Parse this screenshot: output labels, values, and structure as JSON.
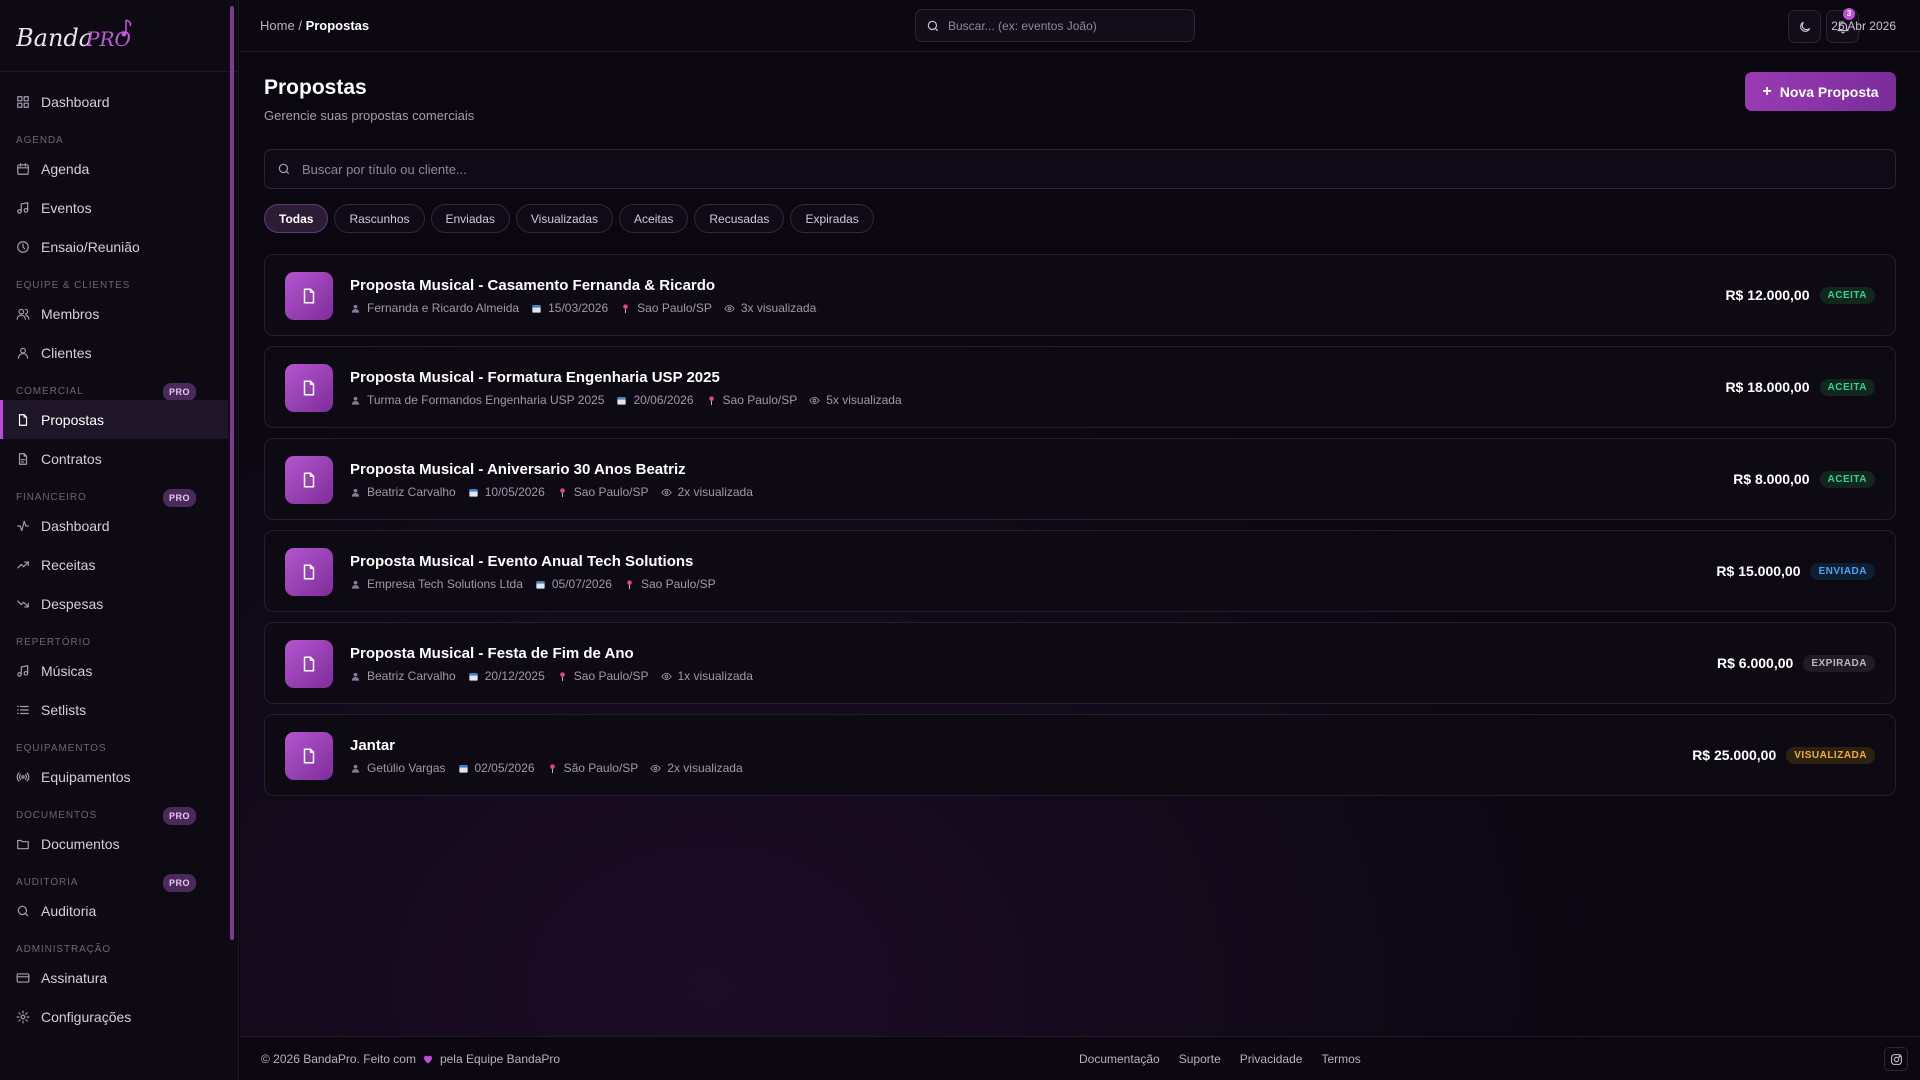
{
  "brand": {
    "name": "BandaPRO"
  },
  "sidebar": {
    "pro_label": "PRO",
    "groups": [
      {
        "label": "",
        "pro": false,
        "items": [
          {
            "label": "Dashboard",
            "icon": "dashboard-icon"
          }
        ]
      },
      {
        "label": "AGENDA",
        "pro": false,
        "items": [
          {
            "label": "Agenda",
            "icon": "calendar-icon"
          },
          {
            "label": "Eventos",
            "icon": "music-note-icon"
          },
          {
            "label": "Ensaio/Reunião",
            "icon": "clock-icon"
          }
        ]
      },
      {
        "label": "EQUIPE & CLIENTES",
        "pro": false,
        "items": [
          {
            "label": "Membros",
            "icon": "users-icon"
          },
          {
            "label": "Clientes",
            "icon": "user-icon"
          }
        ]
      },
      {
        "label": "COMERCIAL",
        "pro": true,
        "items": [
          {
            "label": "Propostas",
            "icon": "file-icon",
            "active": true
          },
          {
            "label": "Contratos",
            "icon": "contract-icon"
          }
        ]
      },
      {
        "label": "FINANCEIRO",
        "pro": true,
        "items": [
          {
            "label": "Dashboard",
            "icon": "activity-icon"
          },
          {
            "label": "Receitas",
            "icon": "trending-up-icon"
          },
          {
            "label": "Despesas",
            "icon": "trending-down-icon"
          }
        ]
      },
      {
        "label": "REPERTÓRIO",
        "pro": false,
        "items": [
          {
            "label": "Músicas",
            "icon": "music-note-icon"
          },
          {
            "label": "Setlists",
            "icon": "list-icon"
          }
        ]
      },
      {
        "label": "EQUIPAMENTOS",
        "pro": false,
        "items": [
          {
            "label": "Equipamentos",
            "icon": "radio-icon"
          }
        ]
      },
      {
        "label": "DOCUMENTOS",
        "pro": true,
        "items": [
          {
            "label": "Documentos",
            "icon": "folder-icon"
          }
        ]
      },
      {
        "label": "AUDITORIA",
        "pro": true,
        "items": [
          {
            "label": "Auditoria",
            "icon": "search-icon"
          }
        ]
      },
      {
        "label": "ADMINISTRAÇÃO",
        "pro": false,
        "items": [
          {
            "label": "Assinatura",
            "icon": "credit-card-icon"
          },
          {
            "label": "Configurações",
            "icon": "gear-icon"
          }
        ]
      }
    ]
  },
  "topbar": {
    "breadcrumb_home": "Home",
    "breadcrumb_sep": "/",
    "breadcrumb_current": "Propostas",
    "search_placeholder": "Buscar... (ex: eventos João)",
    "notification_count": "3",
    "date": "25 Abr 2026"
  },
  "page": {
    "title": "Propostas",
    "subtitle": "Gerencie suas propostas comerciais",
    "new_button": "Nova Proposta",
    "search_placeholder": "Buscar por título ou cliente..."
  },
  "filters": [
    "Todas",
    "Rascunhos",
    "Enviadas",
    "Visualizadas",
    "Aceitas",
    "Recusadas",
    "Expiradas"
  ],
  "active_filter": 0,
  "proposals": [
    {
      "title": "Proposta Musical - Casamento Fernanda & Ricardo",
      "client": "Fernanda e Ricardo Almeida",
      "date": "15/03/2026",
      "location": "Sao Paulo/SP",
      "views": "3x visualizada",
      "price": "R$ 12.000,00",
      "status": "ACEITA",
      "status_key": "aceita"
    },
    {
      "title": "Proposta Musical - Formatura Engenharia USP 2025",
      "client": "Turma de Formandos Engenharia USP 2025",
      "date": "20/06/2026",
      "location": "Sao Paulo/SP",
      "views": "5x visualizada",
      "price": "R$ 18.000,00",
      "status": "ACEITA",
      "status_key": "aceita"
    },
    {
      "title": "Proposta Musical - Aniversario 30 Anos Beatriz",
      "client": "Beatriz Carvalho",
      "date": "10/05/2026",
      "location": "Sao Paulo/SP",
      "views": "2x visualizada",
      "price": "R$ 8.000,00",
      "status": "ACEITA",
      "status_key": "aceita"
    },
    {
      "title": "Proposta Musical - Evento Anual Tech Solutions",
      "client": "Empresa Tech Solutions Ltda",
      "date": "05/07/2026",
      "location": "Sao Paulo/SP",
      "views": "",
      "price": "R$ 15.000,00",
      "status": "ENVIADA",
      "status_key": "enviada"
    },
    {
      "title": "Proposta Musical - Festa de Fim de Ano",
      "client": "Beatriz Carvalho",
      "date": "20/12/2025",
      "location": "Sao Paulo/SP",
      "views": "1x visualizada",
      "price": "R$ 6.000,00",
      "status": "EXPIRADA",
      "status_key": "expirada"
    },
    {
      "title": "Jantar",
      "client": "Getúlio Vargas",
      "date": "02/05/2026",
      "location": "São Paulo/SP",
      "views": "2x visualizada",
      "price": "R$ 25.000,00",
      "status": "VISUALIZADA",
      "status_key": "visualizada"
    }
  ],
  "footer": {
    "copyright": "© 2026 BandaPro.",
    "made_with": "Feito com",
    "by_team": "pela Equipe BandaPro",
    "links": [
      "Documentação",
      "Suporte",
      "Privacidade",
      "Termos"
    ]
  },
  "colors": {
    "accent": "#b64dd6",
    "status_aceita": "#33d18a",
    "status_enviada": "#49a4f2",
    "status_expirada": "#bcb5c6",
    "status_visualizada": "#f0b02e"
  }
}
